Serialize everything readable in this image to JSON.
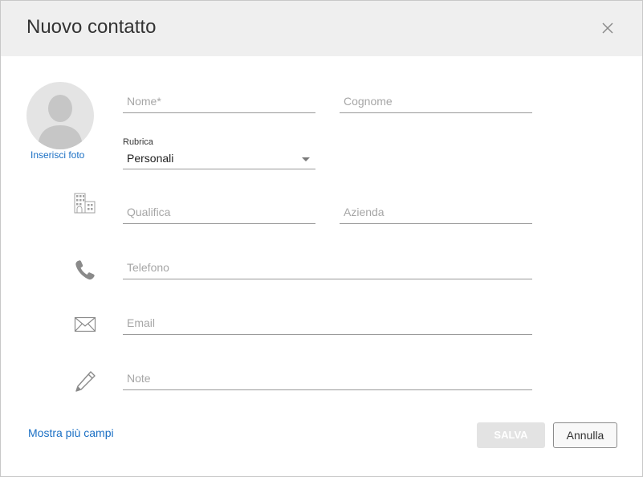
{
  "dialog": {
    "title": "Nuovo contatto",
    "close_icon": "close-icon"
  },
  "photo": {
    "avatar_icon": "person-avatar-icon",
    "link_label": "Inserisci foto"
  },
  "fields": {
    "first_name": {
      "placeholder": "Nome*",
      "value": ""
    },
    "last_name": {
      "placeholder": "Cognome",
      "value": ""
    },
    "address_book": {
      "label": "Rubrica",
      "selected": "Personali",
      "icon": "chevron-down-icon"
    },
    "job_title": {
      "placeholder": "Qualifica",
      "value": "",
      "icon": "building-icon"
    },
    "company": {
      "placeholder": "Azienda",
      "value": ""
    },
    "phone": {
      "placeholder": "Telefono",
      "value": "",
      "icon": "phone-icon"
    },
    "email": {
      "placeholder": "Email",
      "value": "",
      "icon": "envelope-icon"
    },
    "notes": {
      "placeholder": "Note",
      "value": "",
      "icon": "pencil-icon"
    }
  },
  "footer": {
    "more_fields_label": "Mostra più campi",
    "save_label": "SALVA",
    "save_enabled": false,
    "cancel_label": "Annulla"
  },
  "colors": {
    "header_bg": "#efefef",
    "link": "#1a6fc4",
    "icon": "#8a8a8a",
    "disabled_button": "#e3e3e3"
  }
}
